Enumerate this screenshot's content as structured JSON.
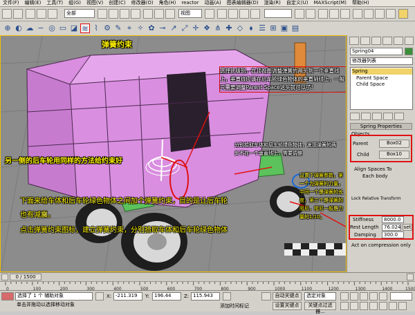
{
  "menu": [
    "文件(F)",
    "编辑(E)",
    "工具(T)",
    "组(G)",
    "视图(V)",
    "创建(C)",
    "修改器(O)",
    "角色(H)",
    "reactor",
    "动画(A)",
    "图表编辑器(D)",
    "渲染(R)",
    "自定义(U)",
    "MAXScript(M)",
    "帮助(H)"
  ],
  "toolbar1": {
    "selection_filter": "全部",
    "view_dropdown": "视图"
  },
  "toolbar2": {
    "spring_label": "弹簧约束"
  },
  "panel": {
    "object_name": "Spring04",
    "modifier_list": "修改器列表",
    "stack": [
      "Spring",
      "Parent Space",
      "Child Space"
    ],
    "rollout_title": "Spring Properties",
    "objects_label": "Objects",
    "parent_label": "Parent",
    "parent_value": "Box02",
    "child_label": "Child",
    "child_value": "Box10",
    "align_label": "Align Spaces To",
    "each_body": "Each body",
    "lock_label": "Lock Relative Transform",
    "stiffness_label": "Stiffness",
    "stiffness_value": "8000.0",
    "rest_label": "Rest Length",
    "rest_value": "76.024",
    "rest_btn": "set",
    "damping_label": "Damping",
    "damping_value": "300.0",
    "act_label": "Act on compression only"
  },
  "annotations": {
    "spring_title": "弹簧约束",
    "top_note": "选择此级别，在顶视图调整弹簧的两头到一个垂直线上，垂直线应该在后车轮绿色物体的垂直轴线上，一般只需要调整Parent Space这头就可以了!",
    "other_side": "另一侧的后车轮用同样的方法给约束好",
    "mid_note": "分别拾取车体和后车轮绿色物体，发现弹簧的两头不在一个垂直线上，需要调整",
    "param_note": "设置下弹簧参数，第一个为弹簧的力量，中间一个是弹簧的长度，第三个是弹簧的阻尼，阻尼一般是力量的1/10。",
    "bottom_note_1": "下面来给车体和后车轮绿色物体之间加个弹簧约束，目的是让后车轮",
    "bottom_note_2": "也有减震。",
    "bottom_note_3": "点击弹簧约束图标，建立弹簧约束，分别拾取车体和后车轮绿色物体"
  },
  "timeline": {
    "frame": "0 / 1500"
  },
  "ruler_ticks": [
    "0",
    "100",
    "200",
    "300",
    "400",
    "500",
    "600",
    "700",
    "800",
    "900",
    "1000",
    "1100",
    "1200",
    "1300",
    "1400",
    "1500"
  ],
  "status": {
    "selected": "选择了 1 个 辅助对象",
    "prompt": "单击并拖动以选择移动对象",
    "x_label": "X:",
    "x_value": "-211.319",
    "y_label": "Y:",
    "y_value": "196.44",
    "z_label": "Z:",
    "z_value": "115.943",
    "add_tag": "添加时间标记",
    "auto_key": "自动关键点",
    "selected_obj": "选定对象",
    "set_key": "设置关键点",
    "key_filter": "关键点过滤器..."
  },
  "colors": {
    "annotation_yellow": "#fff200",
    "red_marker": "#e01010",
    "viewport_bg": "#8c8c8c",
    "car_body": "#d98ee0",
    "green_part": "#5cc35c"
  }
}
